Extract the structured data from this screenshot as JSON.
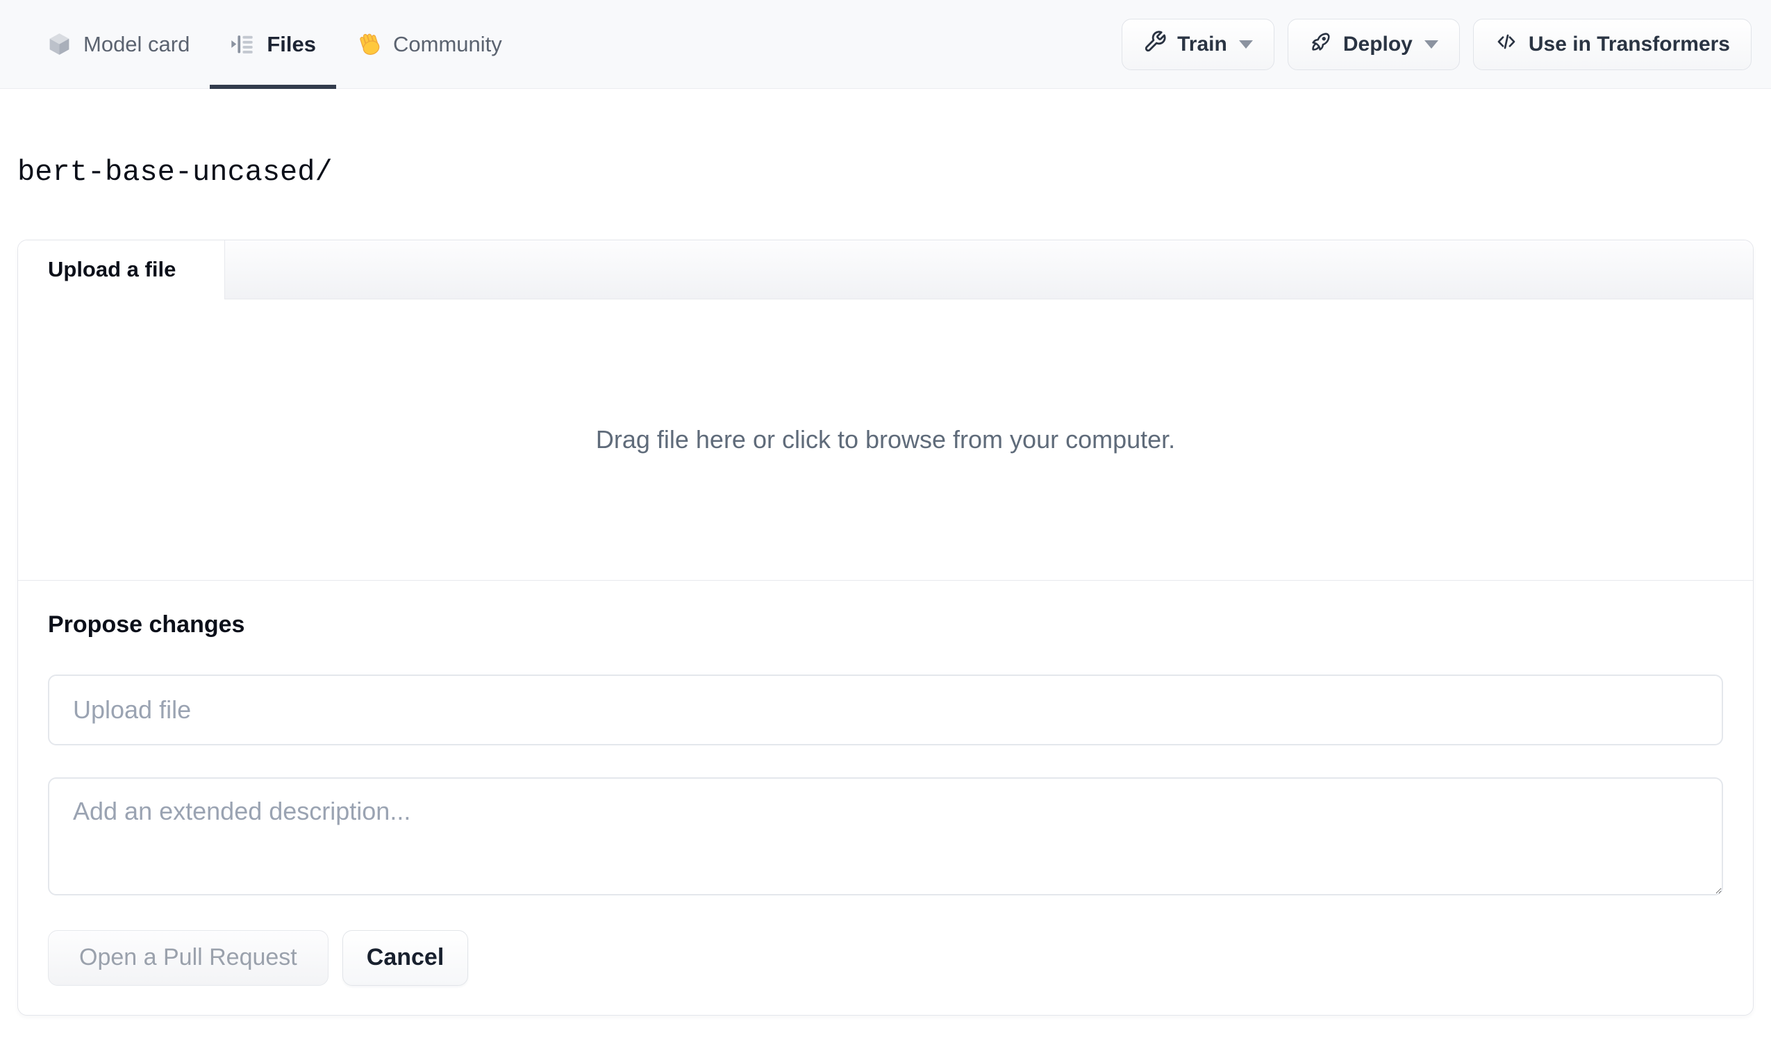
{
  "nav": {
    "tabs": [
      {
        "label": "Model card",
        "icon": "cube-icon"
      },
      {
        "label": "Files",
        "icon": "file-versions-icon",
        "active": true
      },
      {
        "label": "Community",
        "icon": "waving-hand-icon"
      }
    ],
    "actions": [
      {
        "label": "Train",
        "icon": "wrench-icon",
        "has_dropdown": true
      },
      {
        "label": "Deploy",
        "icon": "rocket-icon",
        "has_dropdown": true
      },
      {
        "label": "Use in Transformers",
        "icon": "code-icon",
        "has_dropdown": false
      }
    ]
  },
  "breadcrumb": {
    "path": "bert-base-uncased/"
  },
  "upload_card": {
    "tab_label": "Upload a file",
    "dropzone_text": "Drag file here or click to browse from your computer.",
    "propose": {
      "heading": "Propose changes",
      "filename_placeholder": "Upload file",
      "description_placeholder": "Add an extended description...",
      "description_value": "",
      "filename_value": "",
      "submit_label": "Open a Pull Request",
      "submit_disabled": true,
      "cancel_label": "Cancel"
    }
  },
  "colors": {
    "nav_background": "#f8f9fb",
    "active_tab_underline": "#333c4d",
    "muted_text": "#5f6b7a",
    "placeholder_text": "#9aa3b2",
    "border": "#e4e6eb",
    "hand_emoji_yellow": "#ffc83d"
  }
}
